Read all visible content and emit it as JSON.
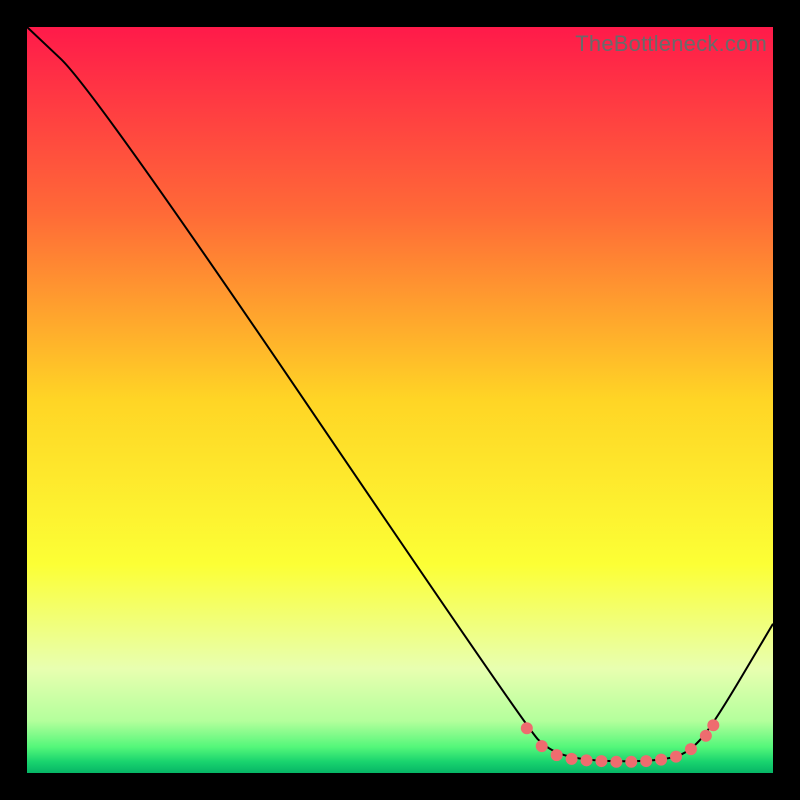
{
  "watermark": "TheBottleneck.com",
  "colors": {
    "marker": "#ee6c6f",
    "line": "#000000"
  },
  "chart_data": {
    "type": "line",
    "title": "",
    "xlabel": "",
    "ylabel": "",
    "xlim": [
      0,
      100
    ],
    "ylim": [
      0,
      100
    ],
    "grid": false,
    "legend": false,
    "background_gradient": [
      {
        "pos": 0.0,
        "color": "#ff1a4a"
      },
      {
        "pos": 0.25,
        "color": "#ff6a37"
      },
      {
        "pos": 0.5,
        "color": "#ffd525"
      },
      {
        "pos": 0.72,
        "color": "#fcff35"
      },
      {
        "pos": 0.86,
        "color": "#e8ffb0"
      },
      {
        "pos": 0.93,
        "color": "#b4ff9c"
      },
      {
        "pos": 0.965,
        "color": "#54f77a"
      },
      {
        "pos": 0.985,
        "color": "#19d36e"
      },
      {
        "pos": 1.0,
        "color": "#06b566"
      }
    ],
    "curve": [
      {
        "x": 0.0,
        "y": 100.0
      },
      {
        "x": 9.0,
        "y": 91.5
      },
      {
        "x": 67.0,
        "y": 6.0
      },
      {
        "x": 70.0,
        "y": 3.0
      },
      {
        "x": 74.0,
        "y": 1.8
      },
      {
        "x": 80.0,
        "y": 1.5
      },
      {
        "x": 86.0,
        "y": 1.8
      },
      {
        "x": 89.0,
        "y": 3.0
      },
      {
        "x": 92.0,
        "y": 6.5
      },
      {
        "x": 100.0,
        "y": 20.0
      }
    ],
    "markers": [
      {
        "x": 67.0,
        "y": 6.0
      },
      {
        "x": 69.0,
        "y": 3.6
      },
      {
        "x": 71.0,
        "y": 2.4
      },
      {
        "x": 73.0,
        "y": 1.9
      },
      {
        "x": 75.0,
        "y": 1.7
      },
      {
        "x": 77.0,
        "y": 1.6
      },
      {
        "x": 79.0,
        "y": 1.5
      },
      {
        "x": 81.0,
        "y": 1.5
      },
      {
        "x": 83.0,
        "y": 1.6
      },
      {
        "x": 85.0,
        "y": 1.8
      },
      {
        "x": 87.0,
        "y": 2.2
      },
      {
        "x": 89.0,
        "y": 3.2
      },
      {
        "x": 91.0,
        "y": 5.0
      },
      {
        "x": 92.0,
        "y": 6.4
      }
    ]
  }
}
